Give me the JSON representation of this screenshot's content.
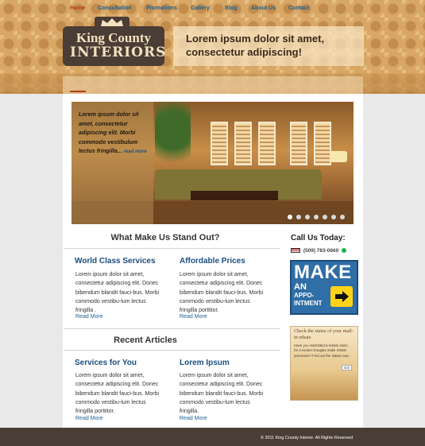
{
  "brand": {
    "name_line1": "King County",
    "name_line2": "INTERIORS",
    "tagline": "Lorem ipsum dolor sit amet, consectetur adipiscing!"
  },
  "nav": {
    "items": [
      {
        "label": "Home",
        "active": true
      },
      {
        "label": "Consultation",
        "active": false
      },
      {
        "label": "Promotions",
        "active": false
      },
      {
        "label": "Gallery",
        "active": false
      },
      {
        "label": "Blog",
        "active": false
      },
      {
        "label": "About Us",
        "active": false
      },
      {
        "label": "Contact",
        "active": false
      }
    ]
  },
  "hero": {
    "text": "Lorem ipsum dolor sit amet, consectetur adipiscing elit.  Morbi commodo vestibulum lectus fringilla...",
    "more_label": "read more",
    "slide_count": 7,
    "active_slide": 1
  },
  "stand_out": {
    "title": "What Make Us Stand Out?",
    "columns": [
      {
        "title": "World Class Services",
        "body": "Lorem ipsum dolor sit amet, consectetur adipiscing elit. Donec bibendum blandit fauci-bus. Morbi commodo vestibu-lum lectus fringilla .",
        "more": "Read More"
      },
      {
        "title": "Affordable Prices",
        "body": "Lorem ipsum dolor sit amet, consectetur adipiscing elit. Donec bibendum blandit fauci-bus. Morbi commodo vestibu-lum lectus fringilla porttitor.",
        "more": "Read More"
      }
    ]
  },
  "articles": {
    "title": "Recent Articles",
    "columns": [
      {
        "title": "Services for You",
        "body": "Lorem ipsum dolor sit amet, consectetur adipiscing elit. Donec bibendum blandit fauci-bus. Morbi commodo vestibu-lum lectus fringilla porttitor.",
        "more": "Read More"
      },
      {
        "title": "Lorem Ipsum",
        "body": "Lorem ipsum dolor sit amet, consectetur adipiscing elit. Donec bibendum blandit fauci-bus. Morbi commodo vestibu-lum lectus fringilla.",
        "more": "Read More"
      }
    ]
  },
  "sidebar": {
    "call_title": "Call Us Today:",
    "phone": "(509) 783-0660",
    "appointment": {
      "make": "MAKE",
      "an": "AN",
      "appointment": "APPO-INTMENT"
    },
    "rebate": {
      "title": "Check the status of your mail-in rebate",
      "body": "Have you submitted a rebate claim for a Hunter Douglas make rebate promotion? Find out the status now.",
      "go": "GO"
    }
  },
  "footer": {
    "copyright": "© 2011 King County Interior. All Rights Reserved"
  },
  "colors": {
    "accent": "#1b4f80",
    "active_nav": "#b04014",
    "brand_dark": "#4a3d35",
    "banner": "#d9a765"
  }
}
